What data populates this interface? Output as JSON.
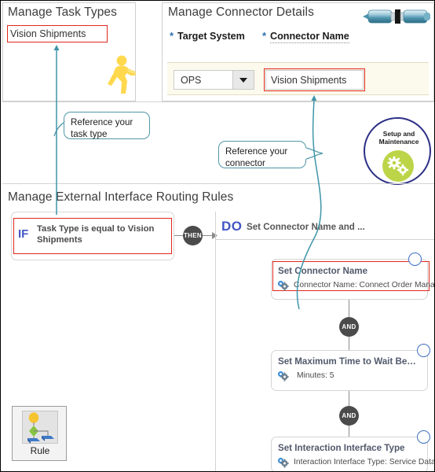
{
  "panels": {
    "task_types": {
      "title": "Manage Task Types",
      "task_type_value": "Vision Shipments",
      "icon": "running-person-icon"
    },
    "connector_details": {
      "title": "Manage Connector Details",
      "icon": "connector-plug-icon",
      "required_marker": "*",
      "labels": {
        "target_system": "Target System",
        "connector_name": "Connector Name"
      },
      "fields": {
        "target_system_value": "OPS",
        "connector_name_value": "Vision Shipments"
      }
    },
    "routing_rules": {
      "title": "Manage External Interface Routing Rules"
    }
  },
  "callouts": [
    {
      "name": "reference-task-type",
      "line1": "Reference  your",
      "line2": "task type"
    },
    {
      "name": "reference-connector",
      "line1": "Reference  your",
      "line2": "connector"
    }
  ],
  "setup_badge": {
    "line1": "Setup and",
    "line2": "Maintenance",
    "icon": "gears-icon"
  },
  "rule": {
    "if_keyword": "IF",
    "if_condition": "Task Type is equal to Vision Shipments",
    "then_keyword": "THEN",
    "do_keyword": "DO",
    "do_summary": "Set Connector Name and ...",
    "and_keyword": "AND",
    "actions": [
      {
        "title": "Set Connector Name",
        "detail": "Connector Name: Connect Order Mana...",
        "icon": "gears-small-icon"
      },
      {
        "title": "Set Maximum Time to Wait Be…",
        "detail": "Minutes: 5",
        "icon": "gears-small-icon"
      },
      {
        "title": "Set Interaction Interface Type",
        "detail": "Interaction Interface Type: Service Data…",
        "icon": "gears-small-icon"
      }
    ]
  },
  "palette": {
    "label": "Rule",
    "icon": "rule-tree-icon"
  },
  "colors": {
    "highlight": "#e0281e",
    "arrow": "#3f95a8",
    "accent_blue": "#4356c4",
    "badge_green": "#bcd548",
    "badge_ring": "#2b2f86",
    "field_strip": "#fcfaec"
  }
}
